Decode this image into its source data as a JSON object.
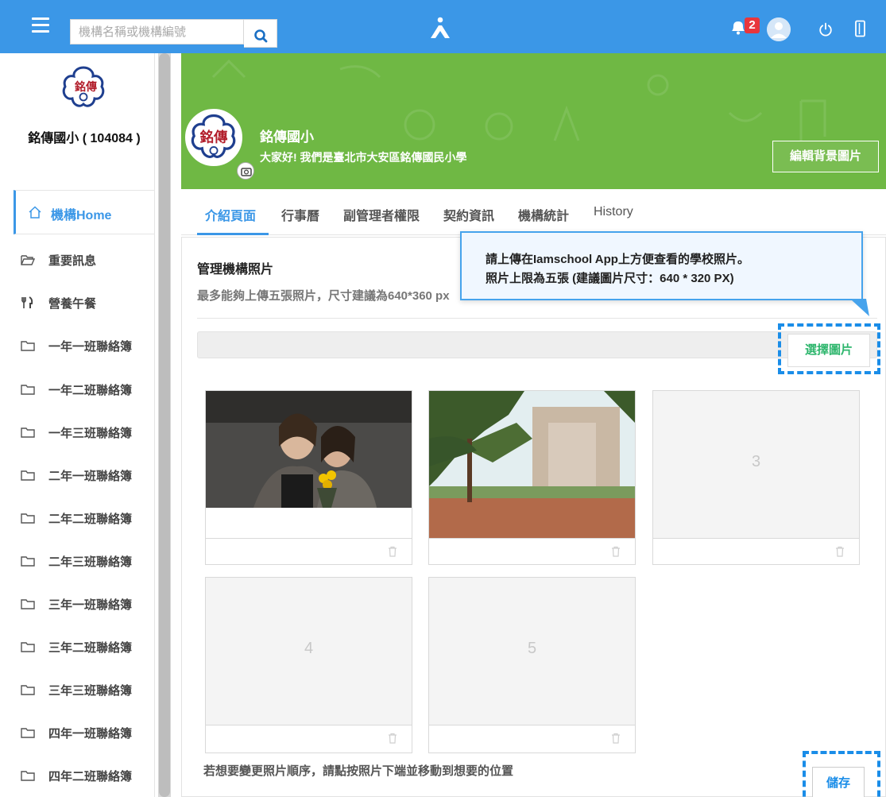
{
  "search": {
    "placeholder": "機構名稱或機構編號"
  },
  "notifications": {
    "count": "2"
  },
  "sidebar": {
    "school_name": "銘傳國小 ( 104084 )",
    "home_label": "機構Home",
    "items": [
      {
        "label": "重要訊息",
        "icon": "folder-open-icon"
      },
      {
        "label": "營養午餐",
        "icon": "utensils-icon"
      },
      {
        "label": "一年一班聯絡簿",
        "icon": "folder-icon"
      },
      {
        "label": "一年二班聯絡簿",
        "icon": "folder-icon"
      },
      {
        "label": "一年三班聯絡簿",
        "icon": "folder-icon"
      },
      {
        "label": "二年一班聯絡簿",
        "icon": "folder-icon"
      },
      {
        "label": "二年二班聯絡簿",
        "icon": "folder-icon"
      },
      {
        "label": "二年三班聯絡簿",
        "icon": "folder-icon"
      },
      {
        "label": "三年一班聯絡簿",
        "icon": "folder-icon"
      },
      {
        "label": "三年二班聯絡簿",
        "icon": "folder-icon"
      },
      {
        "label": "三年三班聯絡簿",
        "icon": "folder-icon"
      },
      {
        "label": "四年一班聯絡簿",
        "icon": "folder-icon"
      },
      {
        "label": "四年二班聯絡簿",
        "icon": "folder-icon"
      }
    ]
  },
  "banner": {
    "title": "銘傳國小",
    "subtitle": "大家好! 我們是臺北市大安區銘傳國民小學",
    "edit_button": "編輯背景圖片",
    "logo_text": "銘傳"
  },
  "tabs": [
    "介紹頁面",
    "行事曆",
    "副管理者權限",
    "契約資訊",
    "機構統計",
    "History"
  ],
  "photos": {
    "title": "管理機構照片",
    "subtitle": "最多能夠上傳五張照片，尺寸建議為640*360 px",
    "choose_button": "選擇圖片",
    "slots": [
      "",
      "",
      "3",
      "4",
      "5"
    ],
    "hint": "若想要變更照片順序，請點按照片下端並移動到想要的位置",
    "save_button": "儲存"
  },
  "tooltip": {
    "line1": "請上傳在Iamschool App上方便查看的學校照片。",
    "line2": "照片上限為五張 (建議圖片尺寸：640 * 320 PX)"
  },
  "colors": {
    "primary": "#3b97e7",
    "banner": "#6fb844",
    "accent_green": "#2eb66d",
    "badge": "#e8363c"
  }
}
